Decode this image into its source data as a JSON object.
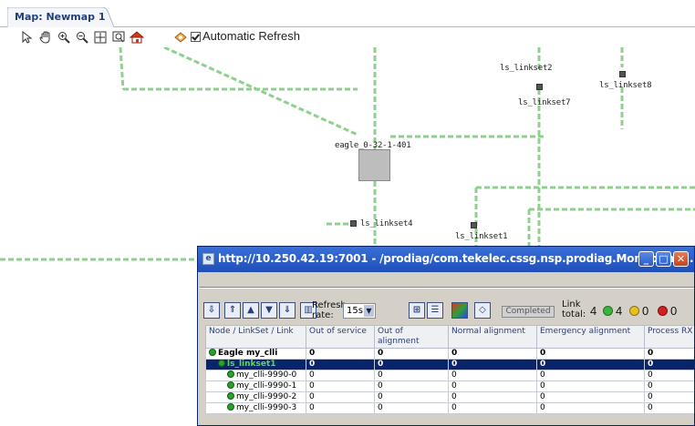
{
  "tab": {
    "label": "Map: Newmap 1"
  },
  "toolbar": {
    "auto_refresh_label": "Automatic Refresh",
    "auto_refresh_checked": true,
    "tools": [
      "pointer-icon",
      "pan-hand-icon",
      "zoom-in-icon",
      "zoom-out-icon",
      "fit-view-icon",
      "zoom-region-icon",
      "home-icon",
      "refresh-link-icon"
    ]
  },
  "map": {
    "eagle_label": "eagle_0-32-1-401",
    "linksets": {
      "ls2": "ls_linkset2",
      "ls7": "ls_linkset7",
      "ls8": "ls_linkset8",
      "ls4": "ls_linkset4",
      "ls1": "ls_linkset1"
    },
    "link_color": "#8fd08f"
  },
  "window": {
    "title": "http://10.250.42.19:7001 - /prodiag/com.tekelec.cssg.nsp.prodiag.Monitoring/...",
    "toolbar": {
      "refresh_label": "Refresh rate:",
      "refresh_value": "15s",
      "status": "Completed",
      "link_total_label": "Link total:",
      "counts": {
        "total": "4",
        "green": "4",
        "yellow": "0",
        "red": "0"
      },
      "colors": {
        "green": "#3cb43c",
        "yellow": "#e8c020",
        "red": "#d02020"
      }
    },
    "table": {
      "headers": [
        "Node / LinkSet / Link",
        "Out of service",
        "Out of alignment",
        "Normal alignment",
        "Emergency alignment",
        "Process RX"
      ],
      "rows": [
        {
          "name": "Eagle my_clli",
          "values": [
            "0",
            "0",
            "0",
            "0",
            "0"
          ]
        },
        {
          "name": "ls_linkset1",
          "values": [
            "0",
            "0",
            "0",
            "0",
            "0"
          ]
        },
        {
          "name": "my_clli-9990-0",
          "values": [
            "0",
            "0",
            "0",
            "0",
            "0"
          ]
        },
        {
          "name": "my_clli-9990-1",
          "values": [
            "0",
            "0",
            "0",
            "0",
            "0"
          ]
        },
        {
          "name": "my_clli-9990-2",
          "values": [
            "0",
            "0",
            "0",
            "0",
            "0"
          ]
        },
        {
          "name": "my_clli-9990-3",
          "values": [
            "0",
            "0",
            "0",
            "0",
            "0"
          ]
        }
      ]
    }
  }
}
